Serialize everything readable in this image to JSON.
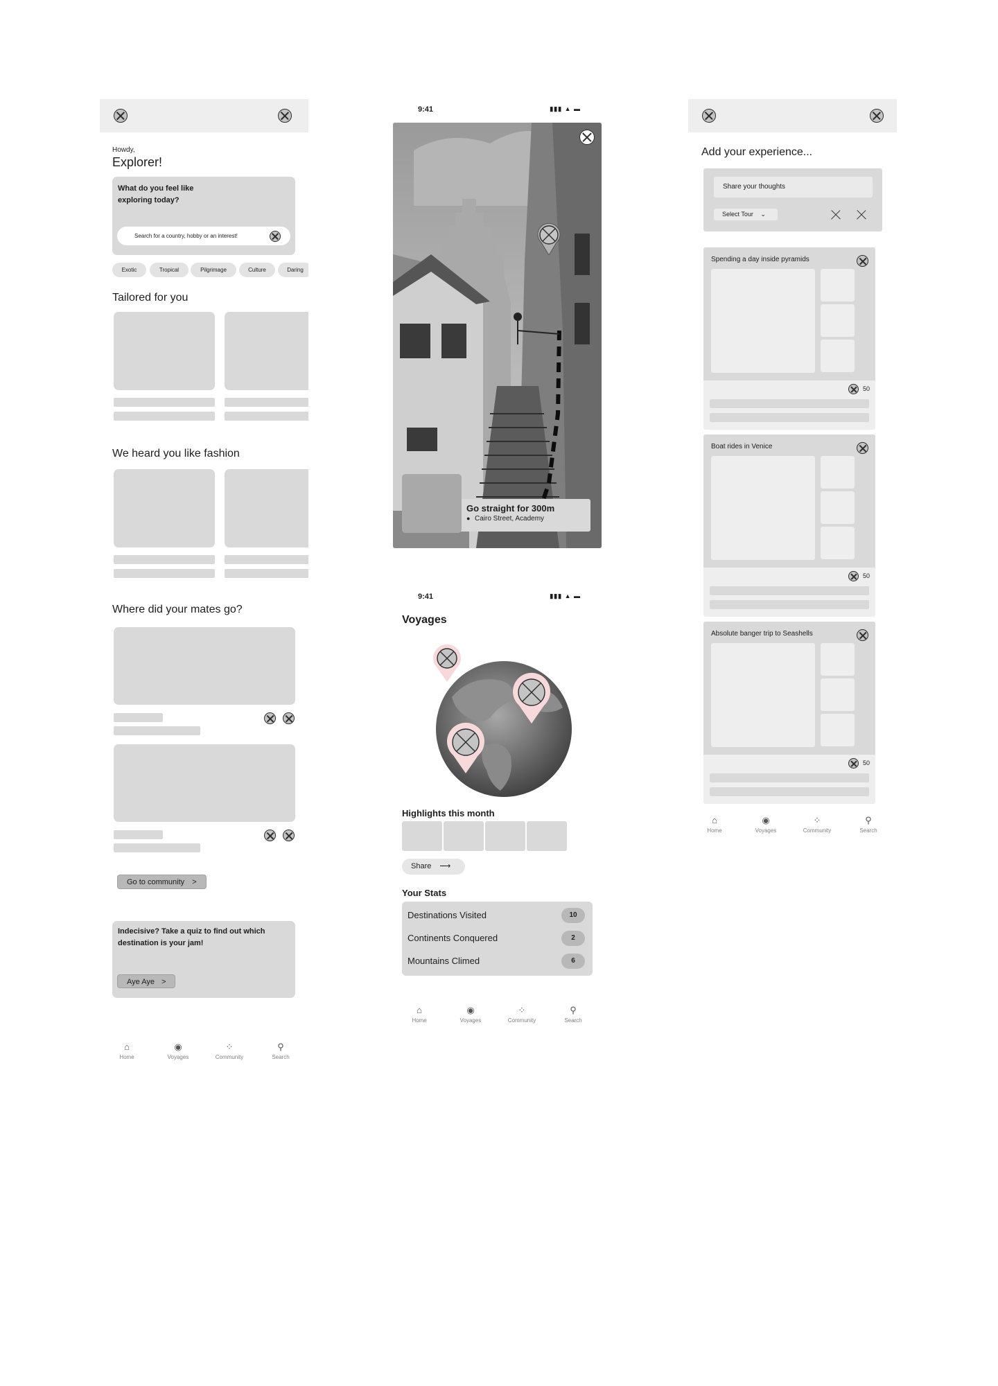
{
  "home": {
    "greeting_small": "Howdy,",
    "greeting_big": "Explorer!",
    "search_question": "What do you feel like exploring today?",
    "search_placeholder": "Search for a country, hobby or an interest!",
    "chips": [
      "Exotic",
      "Tropical",
      "Pilgrimage",
      "Culture",
      "Daring"
    ],
    "section_tailored": "Tailored for you",
    "section_fashion": "We heard you like fashion",
    "section_mates": "Where did your mates go?",
    "go_community_label": "Go to community",
    "go_community_arrow": ">",
    "quiz_text": "Indecisive? Take a quiz to find out which destination is your jam!",
    "quiz_button": "Aye Aye",
    "quiz_arrow": ">"
  },
  "nav": {
    "items": [
      {
        "label": "Home",
        "icon": "home-icon"
      },
      {
        "label": "Voyages",
        "icon": "globe-icon"
      },
      {
        "label": "Community",
        "icon": "community-icon"
      },
      {
        "label": "Search",
        "icon": "search-icon"
      }
    ]
  },
  "status": {
    "time": "9:41"
  },
  "navigation": {
    "instruction": "Go straight for 300m",
    "location": "Cairo Street, Academy"
  },
  "voyages": {
    "title": "Voyages",
    "highlights_title": "Highlights this month",
    "share_label": "Share",
    "stats_title": "Your Stats",
    "stats": [
      {
        "label": "Destinations Visited",
        "value": "10"
      },
      {
        "label": "Continents Conquered",
        "value": "2"
      },
      {
        "label": "Mountains Climed",
        "value": "6"
      }
    ]
  },
  "experience": {
    "heading": "Add your experience...",
    "thoughts_placeholder": "Share your thoughts",
    "select_tour": "Select Tour",
    "posts": [
      {
        "title": "Spending a day inside pyramids",
        "count": "50"
      },
      {
        "title": "Boat rides in Venice",
        "count": "50"
      },
      {
        "title": "Absolute banger trip to Seashells",
        "count": "50"
      }
    ]
  },
  "colors": {
    "card_grey": "#d9d9d9",
    "topbar_grey": "#eeeeee",
    "pin_pink": "#f7d9dc"
  }
}
